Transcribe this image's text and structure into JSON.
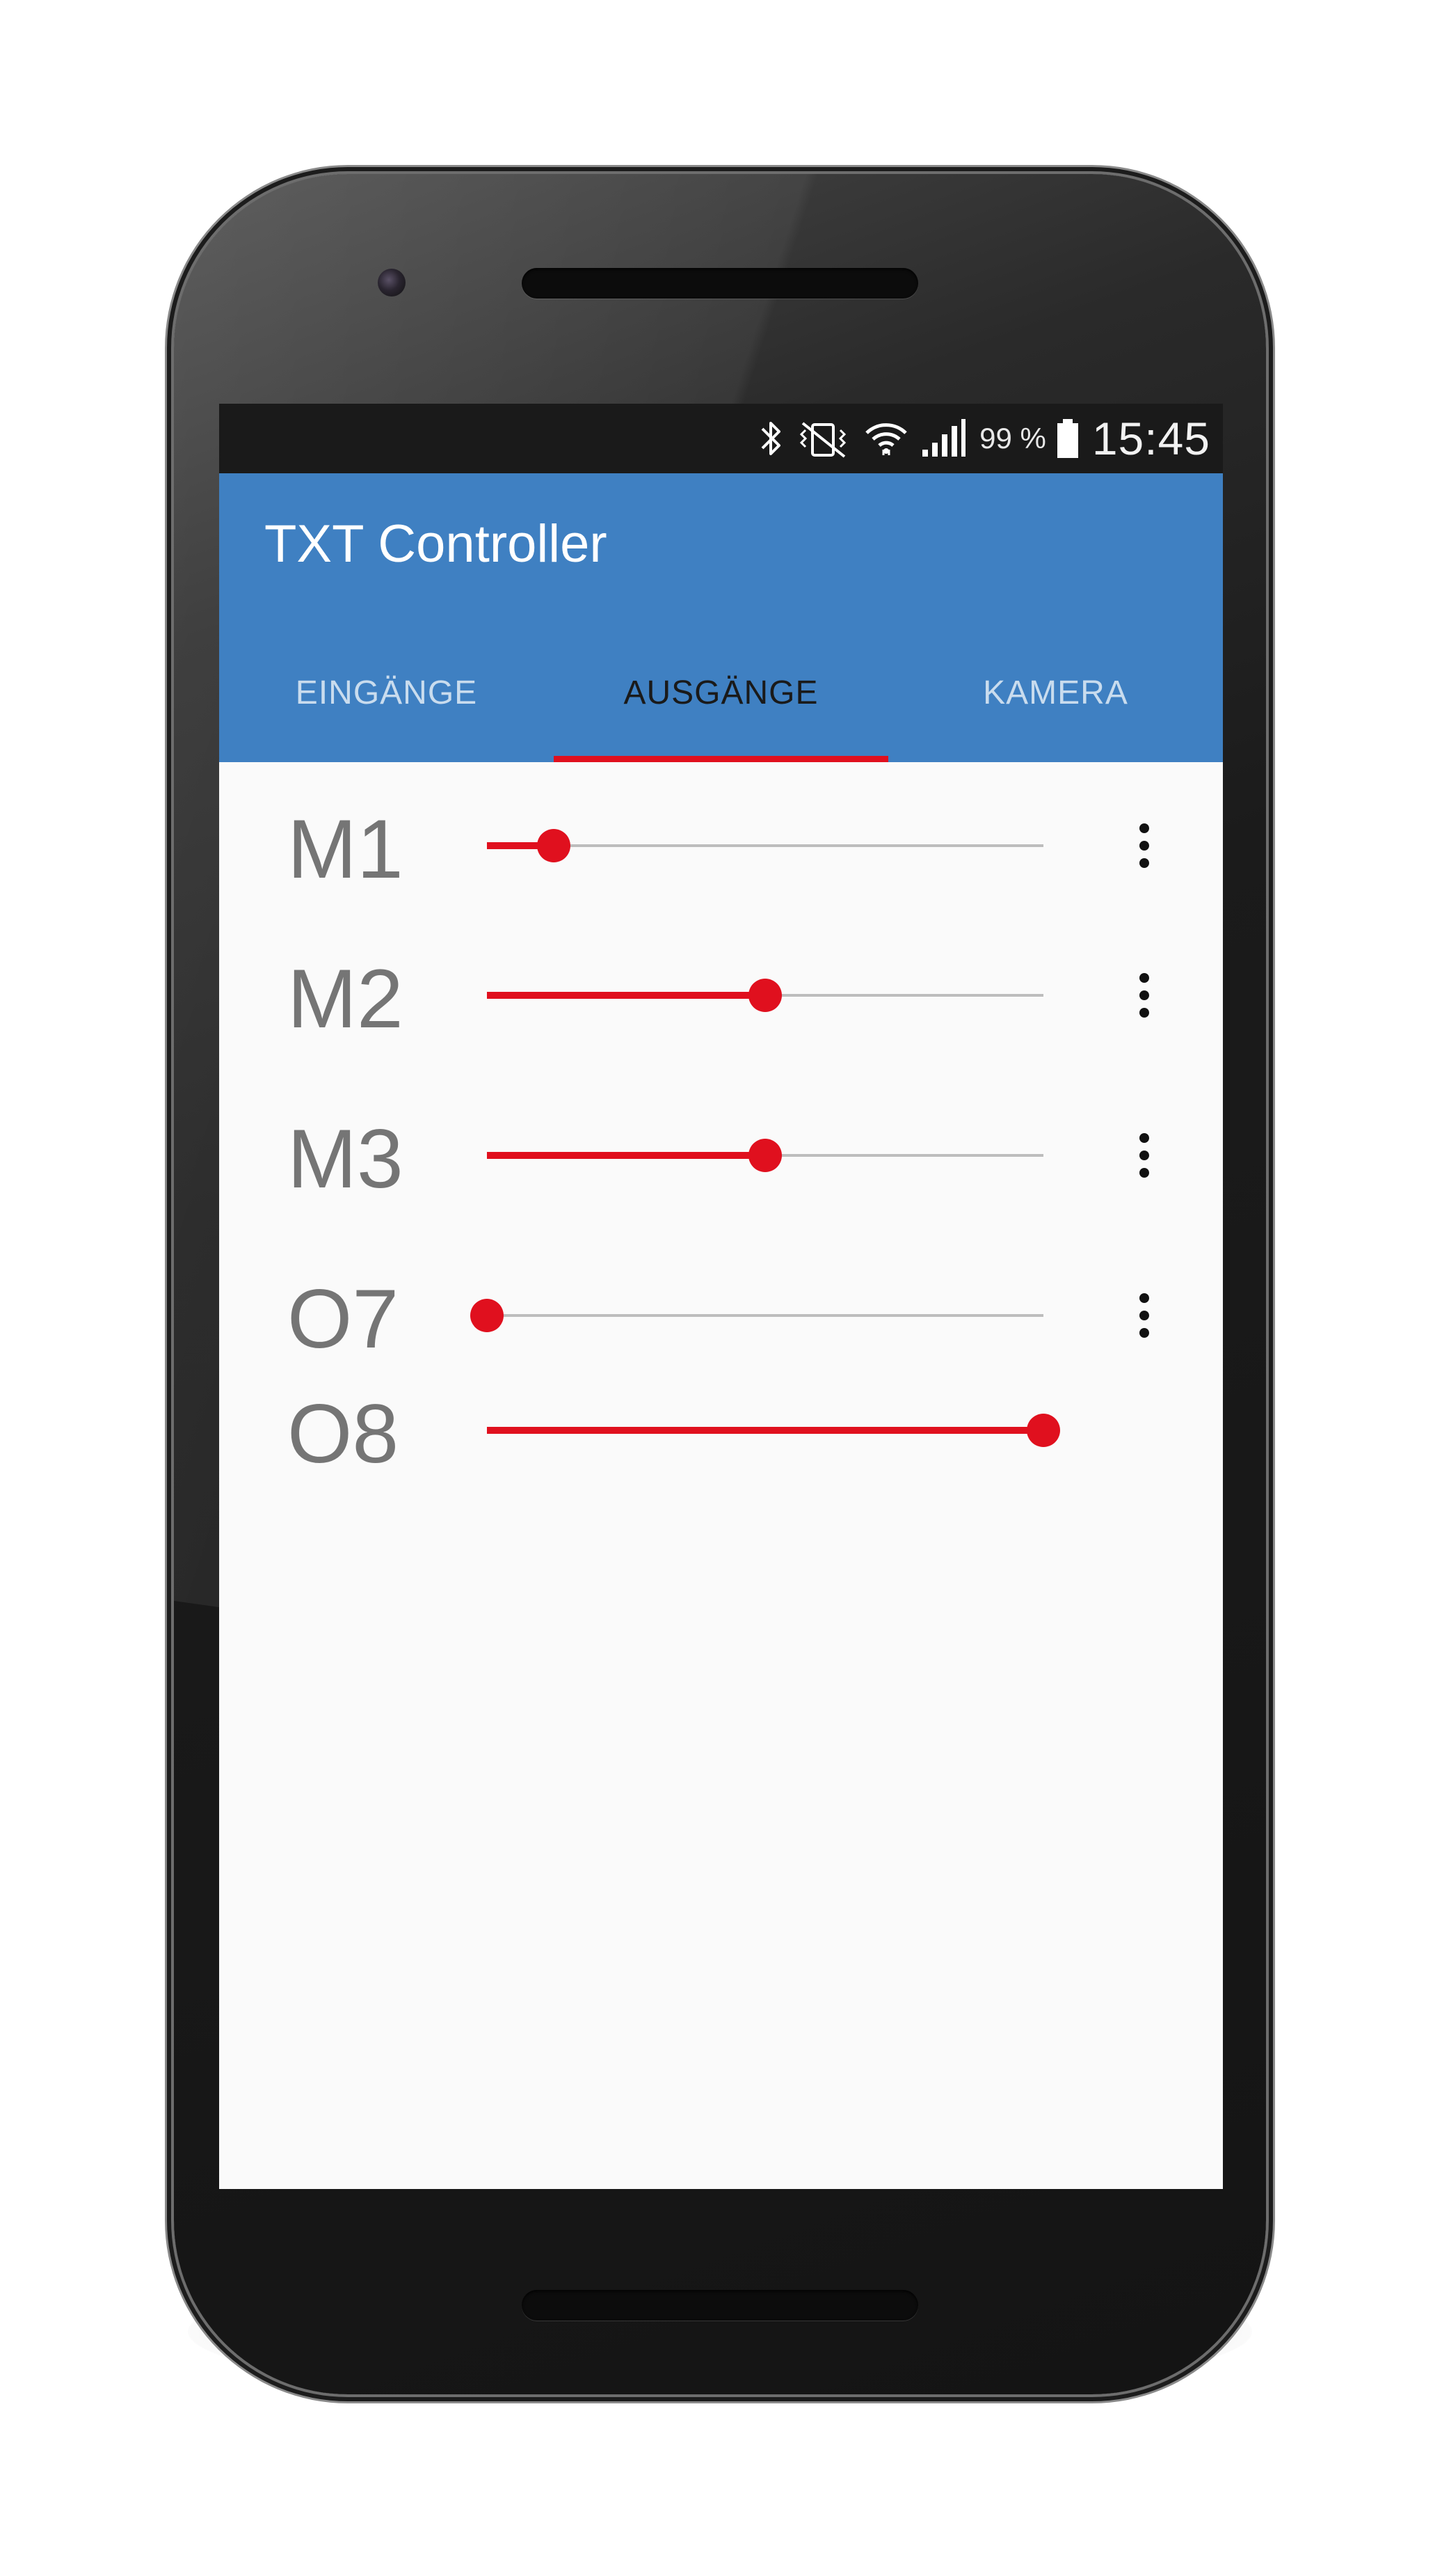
{
  "status_bar": {
    "icons": [
      "bluetooth-icon",
      "vibrate-mute-icon",
      "wifi-icon",
      "signal-icon",
      "battery-icon"
    ],
    "battery_text": "99 %",
    "time": "15:45"
  },
  "app_bar": {
    "title": "TXT Controller",
    "color": "#3f80c2"
  },
  "tabs": [
    {
      "label": "EINGÄNGE",
      "active": false
    },
    {
      "label": "AUSGÄNGE",
      "active": true
    },
    {
      "label": "KAMERA",
      "active": false
    }
  ],
  "accent_color": "#e0101e",
  "outputs": [
    {
      "label": "M1",
      "value": 0.12,
      "has_menu": true
    },
    {
      "label": "M2",
      "value": 0.5,
      "has_menu": true
    },
    {
      "label": "M3",
      "value": 0.5,
      "has_menu": true
    },
    {
      "label": "O7",
      "value": 0.0,
      "has_menu": true
    },
    {
      "label": "O8",
      "value": 1.0,
      "has_menu": false
    }
  ]
}
